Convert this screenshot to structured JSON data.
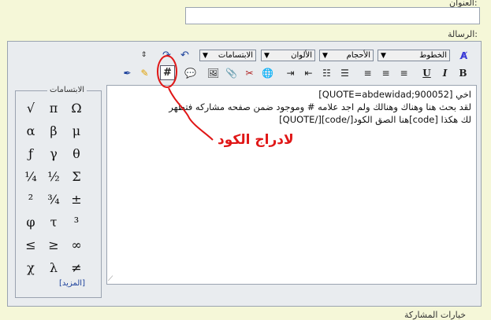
{
  "form": {
    "title_label": "العنوان:",
    "message_label": "الرسالة:"
  },
  "toolbar": {
    "font_label": "الخطوط",
    "size_label": "الأحجام",
    "color_label": "الألوان",
    "smilies_label": "الابتسامات",
    "code_label": "#"
  },
  "message": {
    "line1": "اخي [QUOTE=abdewidad;900052]",
    "line2": "لقد بحث هنا وهناك وهنالك ولم اجد علامه # وموجود ضمن صفحه مشاركه فتظهر",
    "line3": "لك هكذا [code]هنا الصق الكود[/code][/QUOTE]"
  },
  "smilies": {
    "legend": "الابتسامات",
    "symbols": [
      "Ω",
      "π",
      "√",
      "μ",
      "β",
      "α",
      "θ",
      "γ",
      "ƒ",
      "Σ",
      "½",
      "¼",
      "±",
      "¾",
      "²",
      "³",
      "τ",
      "φ",
      "∞",
      "≥",
      "≤",
      "≠",
      "λ",
      "χ"
    ],
    "more_label": "[المزيد]"
  },
  "annotation": {
    "text": "لادراج الكود",
    "color": "#e01616"
  },
  "footer": {
    "partial_text": "خيارات المشاركة"
  }
}
